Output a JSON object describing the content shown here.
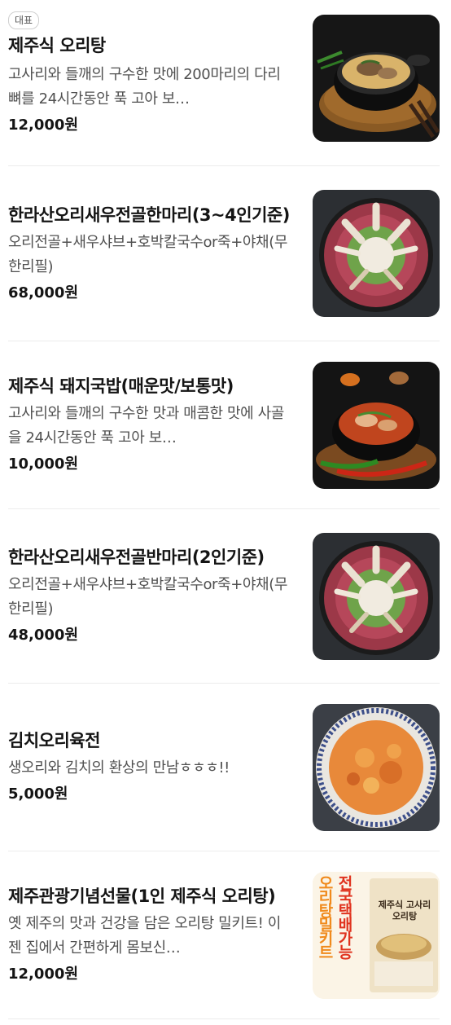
{
  "items": [
    {
      "badge": "대표",
      "name": "제주식 오리탕",
      "desc": "고사리와 들깨의 구수한 맛에 200마리의 다리뼈를 24시간동안 푹 고아 보…",
      "price": "12,000원",
      "image": "duck-soup-photo"
    },
    {
      "name": "한라산오리새우전골한마리(3~4인기준)",
      "desc": "오리전골+새우샤브+호박칼국수or죽+야채(무한리필)",
      "price": "68,000원",
      "image": "duck-shrimp-hotpot-photo"
    },
    {
      "name": "제주식 돼지국밥(매운맛/보통맛)",
      "desc": "고사리와 들깨의 구수한 맛과 매콤한 맛에 사골을 24시간동안 푹 고아 보…",
      "price": "10,000원",
      "image": "pork-rice-soup-photo"
    },
    {
      "name": "한라산오리새우전골반마리(2인기준)",
      "desc": "오리전골+새우샤브+호박칼국수or죽+야채(무한리필)",
      "price": "48,000원",
      "image": "duck-shrimp-hotpot-photo"
    },
    {
      "name": "김치오리육전",
      "desc": "생오리와 김치의 환상의 만남ㅎㅎㅎ!!",
      "price": "5,000원",
      "image": "kimchi-duck-pancake-photo"
    },
    {
      "name": "제주관광기념선물(1인 제주식 오리탕)",
      "desc": "옛 제주의 맛과 건강을 담은 오리탕 밀키트! 이젠 집에서 간편하게 몸보신…",
      "price": "12,000원",
      "image": "meal-kit-package-photo",
      "package_text_left": "오리탕밀키트",
      "package_text_right": "전국택배가능",
      "package_title": "제주식 고사리 오리탕"
    }
  ],
  "colors": {
    "text": "#141414",
    "desc": "#505050",
    "divider": "#ececec",
    "package_orange": "#f08a1c",
    "package_red": "#e0331f"
  }
}
